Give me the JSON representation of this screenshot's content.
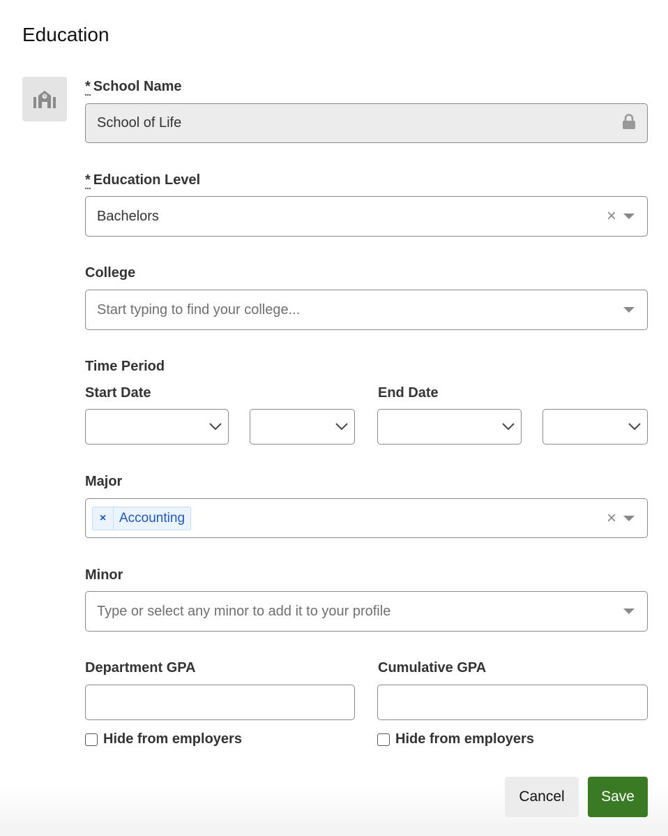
{
  "title": "Education",
  "school_name": {
    "label": "School Name",
    "required_marker": "*",
    "value": "School of Life",
    "locked": true
  },
  "education_level": {
    "label": "Education Level",
    "required_marker": "*",
    "value": "Bachelors"
  },
  "college": {
    "label": "College",
    "placeholder": "Start typing to find your college..."
  },
  "time_period": {
    "label": "Time Period",
    "start_date": {
      "label": "Start Date",
      "month": "",
      "year": ""
    },
    "end_date": {
      "label": "End Date",
      "month": "",
      "year": ""
    }
  },
  "major": {
    "label": "Major",
    "tags": [
      {
        "remove": "×",
        "label": "Accounting"
      }
    ]
  },
  "minor": {
    "label": "Minor",
    "placeholder": "Type or select any minor to add it to your profile"
  },
  "department_gpa": {
    "label": "Department GPA",
    "value": "",
    "hide_label": "Hide from employers",
    "hide_checked": false
  },
  "cumulative_gpa": {
    "label": "Cumulative GPA",
    "value": "",
    "hide_label": "Hide from employers",
    "hide_checked": false
  },
  "icons": {
    "clear": "×"
  },
  "buttons": {
    "cancel": "Cancel",
    "save": "Save"
  },
  "colors": {
    "save_bg": "#3a7a24",
    "tag_bg": "#eaf3fe",
    "tag_text": "#1f58b8"
  }
}
